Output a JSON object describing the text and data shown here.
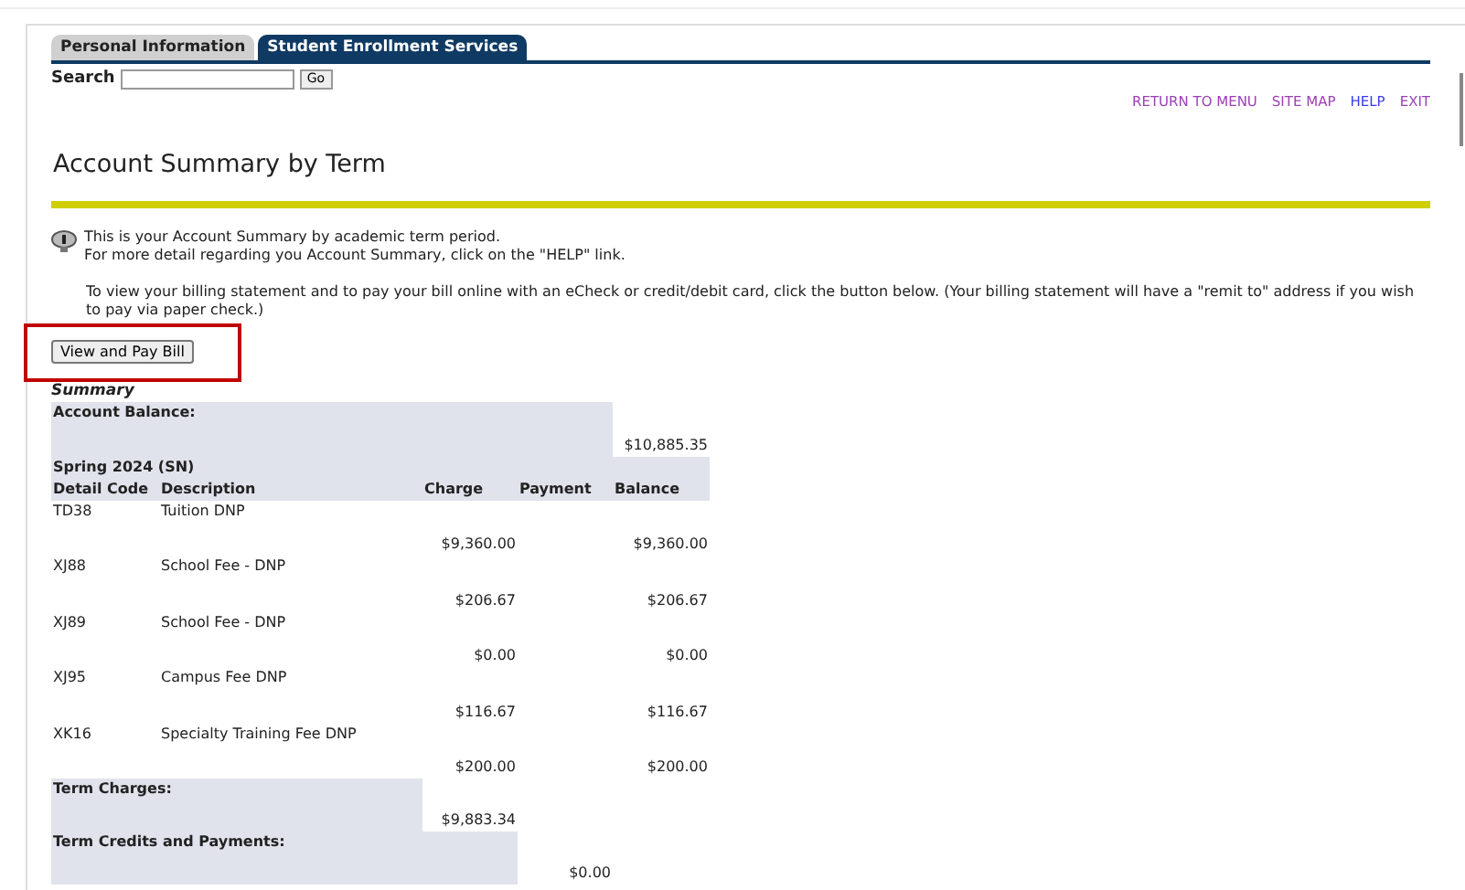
{
  "tabs": [
    {
      "label": "Personal Information",
      "selected": false
    },
    {
      "label": "Student Enrollment Services",
      "selected": true
    }
  ],
  "search": {
    "label": "Search",
    "button": "Go"
  },
  "nav_links": [
    {
      "label": "RETURN TO MENU",
      "visited": true
    },
    {
      "label": "SITE MAP",
      "visited": true
    },
    {
      "label": "HELP",
      "visited": false
    },
    {
      "label": "EXIT",
      "visited": true
    }
  ],
  "title": "Account Summary by Term",
  "info": {
    "lines": [
      "This is your Account Summary by academic term period.",
      "For more detail regarding you Account Summary, click on the \"HELP\" link."
    ],
    "paragraph": "To view your billing statement and to pay your bill online with an eCheck or credit/debit card, click the button below. (Your billing statement will have a \"remit to\" address if you wish to pay via paper check.)"
  },
  "pay_button": {
    "label": "View and Pay Bill",
    "highlighted": true
  },
  "summary": {
    "caption": "Summary",
    "account_balance": {
      "label": "Account Balance:",
      "amount": "$10,885.35"
    },
    "term": "Spring 2024 (SN)",
    "columns": [
      "Detail Code",
      "Description",
      "Charge",
      "Payment",
      "Balance"
    ],
    "rows": [
      {
        "code": "TD38",
        "description": "Tuition DNP",
        "charge": "$9,360.00",
        "balance": "$9,360.00"
      },
      {
        "code": "XJ88",
        "description": "School Fee - DNP",
        "charge": "$206.67",
        "balance": "$206.67"
      },
      {
        "code": "XJ89",
        "description": "School Fee - DNP",
        "charge": "$0.00",
        "balance": "$0.00"
      },
      {
        "code": "XJ95",
        "description": "Campus Fee DNP",
        "charge": "$116.67",
        "balance": "$116.67"
      },
      {
        "code": "XK16",
        "description": "Specialty Training Fee DNP",
        "charge": "$200.00",
        "balance": "$200.00"
      }
    ],
    "totals": [
      {
        "kind": "charge",
        "label": "Term Charges:",
        "amount": "$9,883.34"
      },
      {
        "kind": "payment",
        "label": "Term Credits and Payments:",
        "amount": "$0.00"
      }
    ]
  }
}
